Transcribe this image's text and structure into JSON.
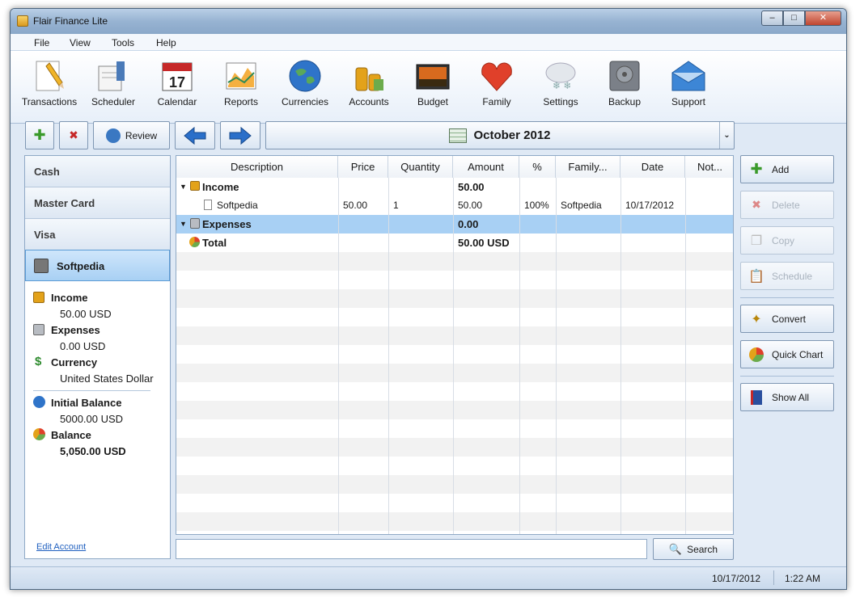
{
  "window": {
    "title": "Flair Finance Lite",
    "minimize": "–",
    "maximize": "□",
    "close": "✕"
  },
  "menu": [
    "File",
    "View",
    "Tools",
    "Help"
  ],
  "toolbar": [
    {
      "label": "Transactions",
      "icon": "transactions-icon"
    },
    {
      "label": "Scheduler",
      "icon": "scheduler-icon"
    },
    {
      "label": "Calendar",
      "icon": "calendar-icon",
      "day": "17"
    },
    {
      "label": "Reports",
      "icon": "reports-icon"
    },
    {
      "label": "Currencies",
      "icon": "globe-icon"
    },
    {
      "label": "Accounts",
      "icon": "coins-icon"
    },
    {
      "label": "Budget",
      "icon": "budget-icon"
    },
    {
      "label": "Family",
      "icon": "heart-icon"
    },
    {
      "label": "Settings",
      "icon": "settings-icon"
    },
    {
      "label": "Backup",
      "icon": "backup-icon"
    },
    {
      "label": "Support",
      "icon": "support-icon"
    }
  ],
  "left_toolbar": {
    "review_label": "Review"
  },
  "period": {
    "label": "October 2012"
  },
  "accounts": [
    "Cash",
    "Master Card",
    "Visa",
    "Softpedia"
  ],
  "account_info": {
    "income_label": "Income",
    "income_value": "50.00 USD",
    "expenses_label": "Expenses",
    "expenses_value": "0.00 USD",
    "currency_label": "Currency",
    "currency_value": "United States Dollar",
    "initial_label": "Initial Balance",
    "initial_value": "5000.00 USD",
    "balance_label": "Balance",
    "balance_value": "5,050.00 USD",
    "edit_link": "Edit Account"
  },
  "table": {
    "columns": [
      "Description",
      "Price",
      "Quantity",
      "Amount",
      "%",
      "Family...",
      "Date",
      "Not..."
    ],
    "rows": [
      {
        "description": "Income",
        "amount": "50.00",
        "type": "group"
      },
      {
        "description": "Softpedia",
        "price": "50.00",
        "quantity": "1",
        "amount": "50.00",
        "percent": "100%",
        "family": "Softpedia",
        "date": "10/17/2012",
        "type": "item"
      },
      {
        "description": "Expenses",
        "amount": "0.00",
        "type": "group"
      },
      {
        "description": "Total",
        "amount": "50.00 USD",
        "type": "total"
      }
    ]
  },
  "right_buttons": {
    "add": "Add",
    "delete": "Delete",
    "copy": "Copy",
    "schedule": "Schedule",
    "convert": "Convert",
    "quick_chart": "Quick Chart",
    "show_all": "Show All"
  },
  "search": {
    "button": "Search",
    "value": ""
  },
  "status": {
    "date": "10/17/2012",
    "time": "1:22 AM"
  }
}
